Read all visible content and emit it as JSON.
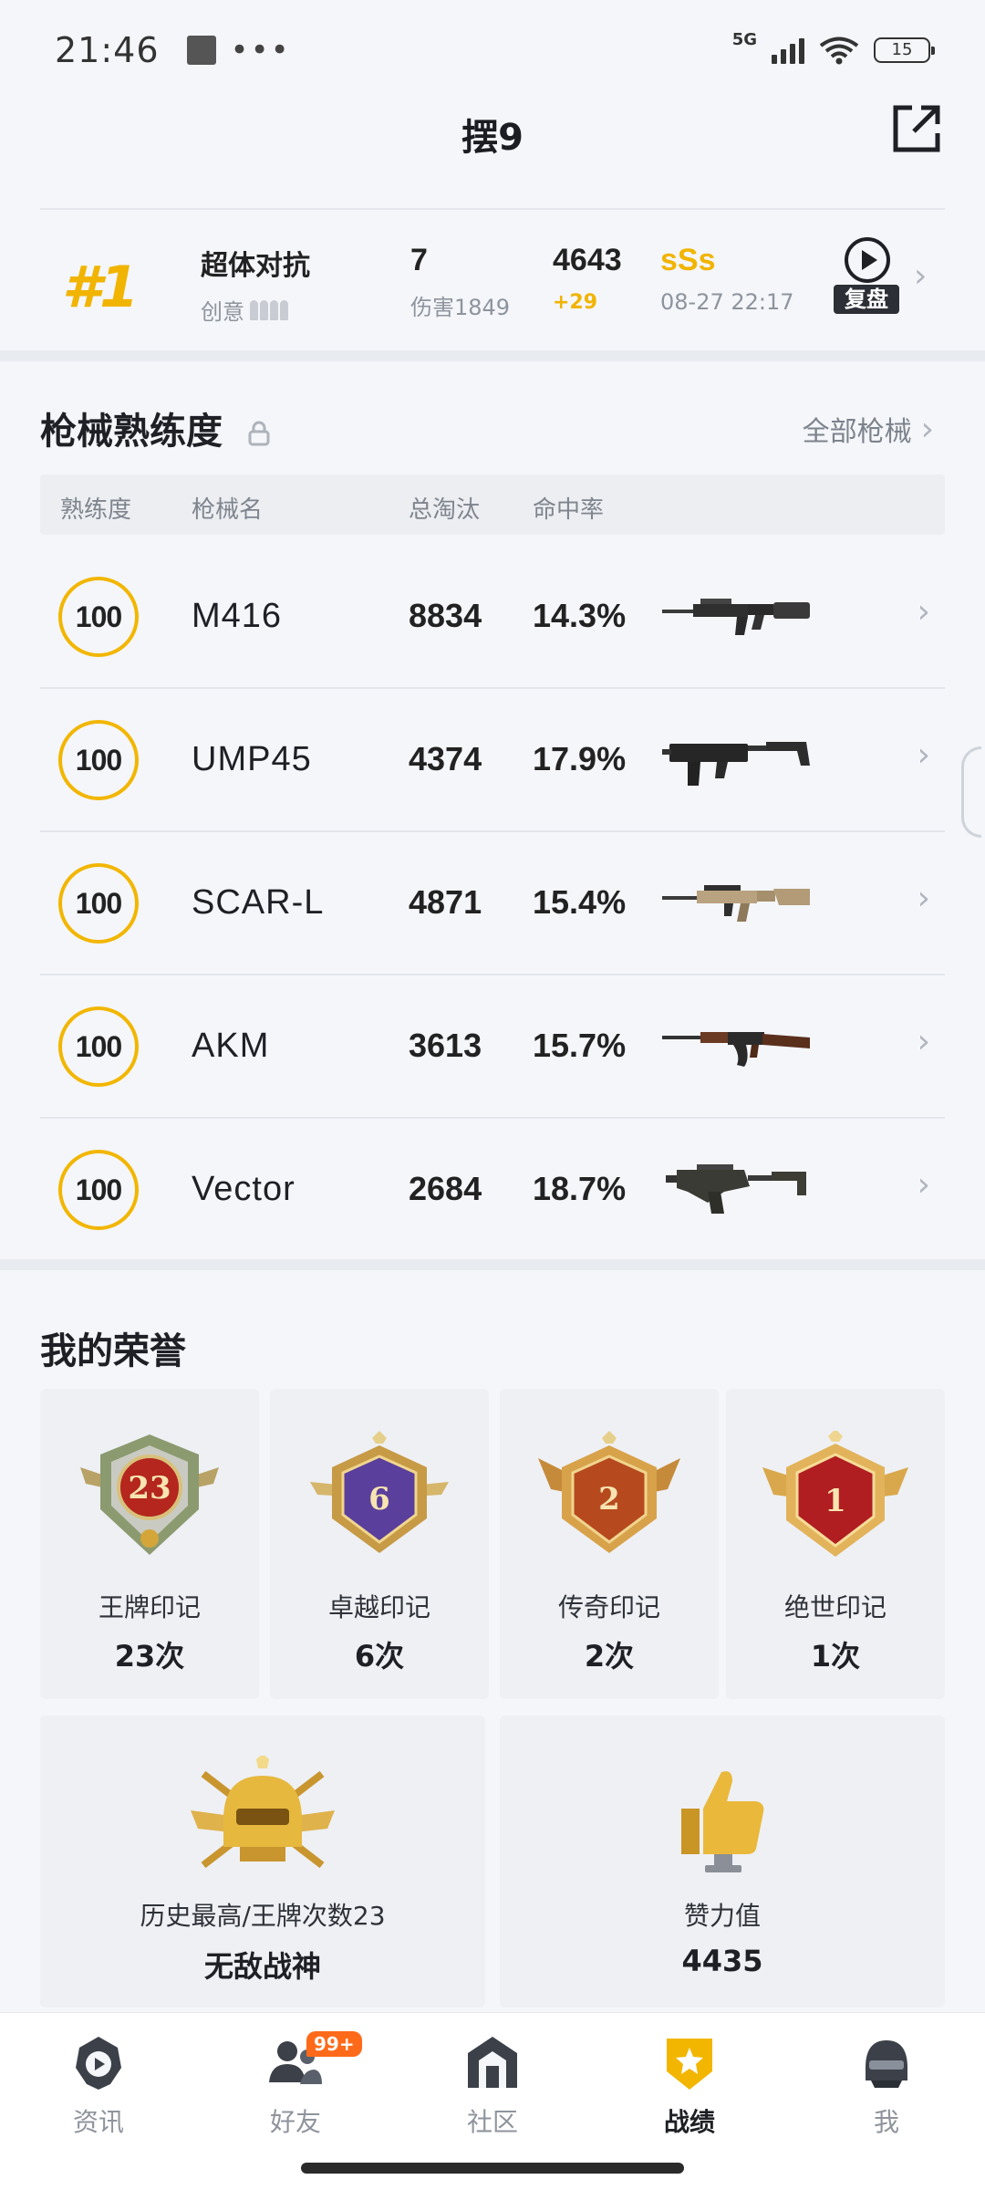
{
  "status_bar": {
    "time": "21:46",
    "network": "5G",
    "wifi_sub": "6",
    "battery": "15"
  },
  "header": {
    "title": "摆9",
    "share_icon": "share-external-icon"
  },
  "recent_match": {
    "rank": "#1",
    "mode": "超体对抗",
    "mode_sub": "创意",
    "kills": "7",
    "damage": "伤害1849",
    "rating": "4643",
    "rating_delta": "+29",
    "grade": "sSs",
    "datetime": "08-27 22:17",
    "replay_label": "复盘"
  },
  "weapons": {
    "section_title": "枪械熟练度",
    "all_link": "全部枪械",
    "columns": [
      "熟练度",
      "枪械名",
      "总淘汰",
      "命中率"
    ],
    "rows": [
      {
        "proficiency": "100",
        "name": "M416",
        "kills": "8834",
        "accuracy": "14.3%"
      },
      {
        "proficiency": "100",
        "name": "UMP45",
        "kills": "4374",
        "accuracy": "17.9%"
      },
      {
        "proficiency": "100",
        "name": "SCAR-L",
        "kills": "4871",
        "accuracy": "15.4%"
      },
      {
        "proficiency": "100",
        "name": "AKM",
        "kills": "3613",
        "accuracy": "15.7%"
      },
      {
        "proficiency": "100",
        "name": "Vector",
        "kills": "2684",
        "accuracy": "18.7%"
      }
    ]
  },
  "honors": {
    "section_title": "我的荣誉",
    "badges": [
      {
        "number": "23",
        "name": "王牌印记",
        "count": "23次"
      },
      {
        "number": "6",
        "name": "卓越印记",
        "count": "6次"
      },
      {
        "number": "2",
        "name": "传奇印记",
        "count": "2次"
      },
      {
        "number": "1",
        "name": "绝世印记",
        "count": "1次"
      }
    ],
    "highest": {
      "label": "历史最高/王牌次数23",
      "value": "无敌战神"
    },
    "likes": {
      "label": "赞力值",
      "value": "4435"
    }
  },
  "bottom_nav": {
    "items": [
      {
        "label": "资讯",
        "icon": "news-icon"
      },
      {
        "label": "好友",
        "icon": "friends-icon",
        "badge": "99+"
      },
      {
        "label": "社区",
        "icon": "community-icon"
      },
      {
        "label": "战绩",
        "icon": "record-icon",
        "active": true
      },
      {
        "label": "我",
        "icon": "profile-icon"
      }
    ]
  },
  "colors": {
    "accent": "#f2b600",
    "background": "#f4f6fa",
    "badge_orange": "#ff6a1a"
  }
}
